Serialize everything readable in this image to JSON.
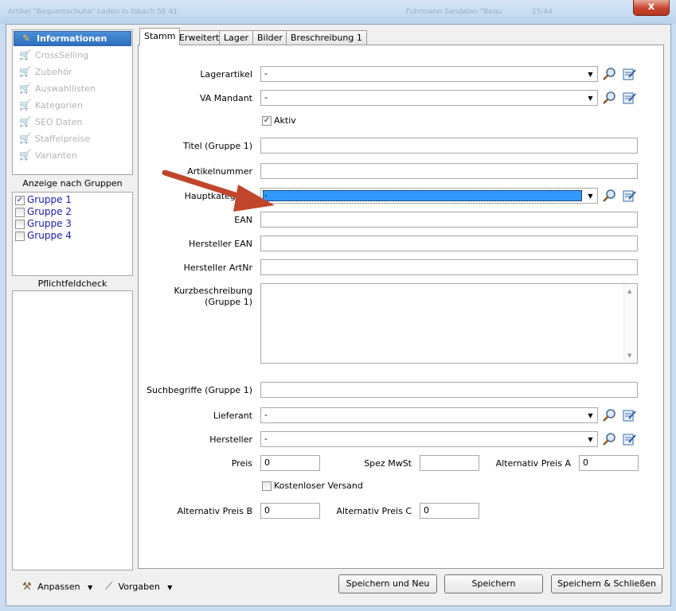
{
  "window": {
    "title_left": "Artikel \"Bequemschuhe\" Laden In Ibbach 56 41",
    "title_right": "Fuhrmann Sandalen \"Bequemschuhe\"",
    "title_time": "15:44",
    "close_glyph": "x"
  },
  "sidebar": {
    "items": [
      {
        "label": "Informationen",
        "icon": "pencil-icon"
      },
      {
        "label": "CrossSelling",
        "icon": "cart-icon"
      },
      {
        "label": "Zubehör",
        "icon": "cart-icon"
      },
      {
        "label": "Auswahllisten",
        "icon": "cart-icon"
      },
      {
        "label": "Kategorien",
        "icon": "cart-icon"
      },
      {
        "label": "SEO Daten",
        "icon": "cart-icon"
      },
      {
        "label": "Staffelpreise",
        "icon": "cart-icon"
      },
      {
        "label": "Varianten",
        "icon": "cart-icon"
      }
    ],
    "groups_title": "Anzeige nach Gruppen",
    "groups": [
      {
        "label": "Gruppe 1",
        "checked": true,
        "mark": "✓"
      },
      {
        "label": "Gruppe 2",
        "checked": false,
        "mark": ""
      },
      {
        "label": "Gruppe 3",
        "checked": false,
        "mark": ""
      },
      {
        "label": "Gruppe 4",
        "checked": false,
        "mark": ""
      }
    ],
    "pflicht_title": "Pflichtfeldcheck"
  },
  "tabs": [
    "Stamm",
    "Erweitert",
    "Lager",
    "Bilder",
    "Breschreibung 1"
  ],
  "form": {
    "lagerartikel": {
      "label": "Lagerartikel",
      "value": "-"
    },
    "va_mandant": {
      "label": "VA Mandant",
      "value": "-"
    },
    "aktiv": {
      "label": "Aktiv",
      "checked": true,
      "mark": "✓"
    },
    "titel": {
      "label": "Titel (Gruppe 1)",
      "value": ""
    },
    "artikelnummer": {
      "label": "Artikelnummer",
      "value": ""
    },
    "hauptkategorie": {
      "label": "Hauptkategorie",
      "value": "-"
    },
    "ean": {
      "label": "EAN",
      "value": ""
    },
    "hersteller_ean": {
      "label": "Hersteller EAN",
      "value": ""
    },
    "hersteller_artnr": {
      "label": "Hersteller ArtNr",
      "value": ""
    },
    "kurzbeschreibung": {
      "label_line1": "Kurzbeschreibung",
      "label_line2": "(Gruppe 1)",
      "value": ""
    },
    "suchbegriffe": {
      "label": "Suchbegriffe (Gruppe 1)",
      "value": ""
    },
    "lieferant": {
      "label": "Lieferant",
      "value": "-"
    },
    "hersteller": {
      "label": "Hersteller",
      "value": "-"
    },
    "preis": {
      "label": "Preis",
      "value": "0"
    },
    "spez_mwst": {
      "label": "Spez MwSt",
      "value": ""
    },
    "alt_preis_a": {
      "label": "Alternativ Preis A",
      "value": "0"
    },
    "kostenloser_versand": {
      "label": "Kostenloser Versand",
      "checked": false,
      "mark": ""
    },
    "alt_preis_b": {
      "label": "Alternativ Preis B",
      "value": "0"
    },
    "alt_preis_c": {
      "label": "Alternativ Preis C",
      "value": "0"
    }
  },
  "toolbar": {
    "anpassen": "Anpassen",
    "vorgaben": "Vorgaben",
    "save_new": "Speichern und Neu",
    "save": "Speichern",
    "save_close": "Speichern & Schließen"
  },
  "colors": {
    "annotation_arrow": "#c0462b",
    "selection": "#3399ff",
    "active_nav": "#3a7bc8"
  }
}
